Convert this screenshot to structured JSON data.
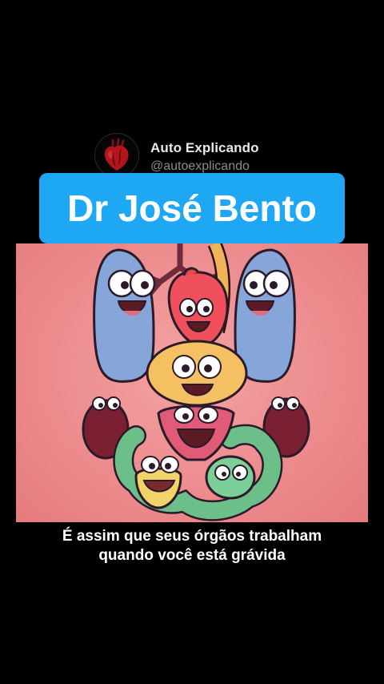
{
  "channel": {
    "name": "Auto Explicando",
    "handle": "@autoexplicando",
    "avatar_icon": "anatomical-heart-icon"
  },
  "banner": {
    "title": "Dr José Bento",
    "color": "#1ea7f3"
  },
  "video": {
    "scene": "cartoon-organs-illustration",
    "background_color": "#ec8a8c"
  },
  "subtitle": {
    "line1": "É assim que seus órgãos trabalham",
    "line2": "quando você está grávida"
  }
}
